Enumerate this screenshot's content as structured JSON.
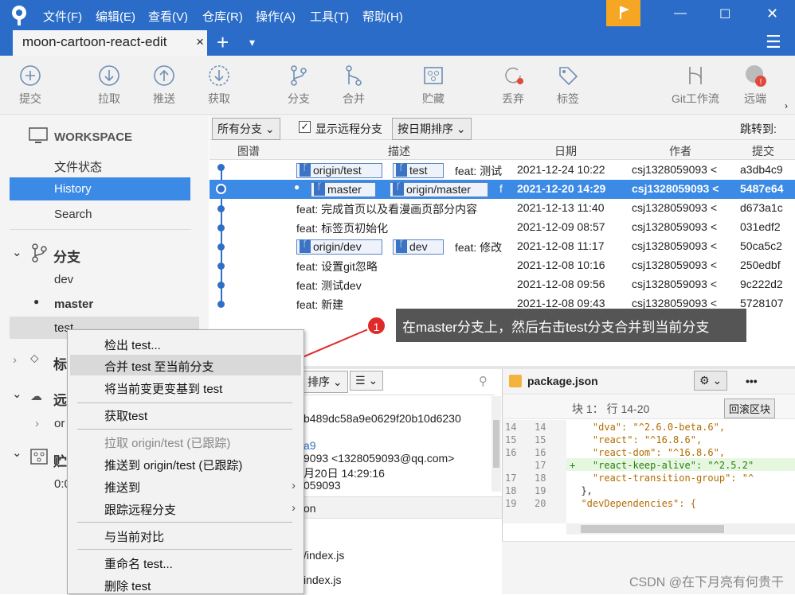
{
  "titlebar": {
    "menus": [
      "文件(F)",
      "编辑(E)",
      "查看(V)",
      "仓库(R)",
      "操作(A)",
      "工具(T)",
      "帮助(H)"
    ],
    "tab_title": "moon-cartoon-react-edit",
    "tab_close": "×",
    "add_tab": "+",
    "dropdown": "▾",
    "minimize": "—",
    "maximize": "☐",
    "close": "✕",
    "menu": "☰"
  },
  "toolbar": {
    "commit": "提交",
    "pull": "拉取",
    "push": "推送",
    "fetch": "获取",
    "branch": "分支",
    "merge": "合并",
    "stash": "贮藏",
    "discard": "丢弃",
    "tag": "标签",
    "gitflow": "Git工作流",
    "remote": "远端"
  },
  "sidebar": {
    "workspace": "WORKSPACE",
    "file_status": "文件状态",
    "history": "History",
    "search": "Search",
    "branches_title": "分支",
    "branches": [
      "dev",
      "master",
      "test"
    ],
    "tags_title": "标",
    "remotes_title": "远",
    "remote_item": "or",
    "stash_title": "贮",
    "stash_item": "0:0"
  },
  "filterbar": {
    "all_branches": "所有分支",
    "show_remote": "显示远程分支",
    "sort_by_date": "按日期排序",
    "jump_to": "跳转到:"
  },
  "columns": {
    "graph": "图谱",
    "desc": "描述",
    "date": "日期",
    "author": "作者",
    "commit": "提交"
  },
  "commits": [
    {
      "tags": [
        "origin/test",
        "test"
      ],
      "desc": "feat: 测试",
      "date": "2021-12-24 10:22",
      "author": "csj1328059093 <",
      "hash": "a3db4c9"
    },
    {
      "tags": [
        "master",
        "origin/master"
      ],
      "desc": "f",
      "date": "2021-12-20 14:29",
      "author": "csj1328059093 <",
      "hash": "5487e64"
    },
    {
      "tags": [],
      "desc": "feat: 完成首页以及看漫画页部分内容",
      "date": "2021-12-13 11:40",
      "author": "csj1328059093 <",
      "hash": "d673a1c"
    },
    {
      "tags": [],
      "desc": "feat: 标签页初始化",
      "date": "2021-12-09 08:57",
      "author": "csj1328059093 <",
      "hash": "031edf2"
    },
    {
      "tags": [
        "origin/dev",
        "dev"
      ],
      "desc": "feat: 修改",
      "date": "2021-12-08 11:17",
      "author": "csj1328059093 <",
      "hash": "50ca5c2"
    },
    {
      "tags": [],
      "desc": "feat: 设置git忽略",
      "date": "2021-12-08 10:16",
      "author": "csj1328059093 <",
      "hash": "250edbf"
    },
    {
      "tags": [],
      "desc": "feat: 测试dev",
      "date": "2021-12-08 09:56",
      "author": "csj1328059093 <",
      "hash": "9c222d2"
    },
    {
      "tags": [],
      "desc": "feat: 新建",
      "date": "2021-12-08 09:43",
      "author": "csj1328059093 <",
      "hash": "5728107"
    }
  ],
  "callout": {
    "badge": "1",
    "text": "在master分支上，然后右击test分支合并到当前分支"
  },
  "midpane": {
    "sort": "排序",
    "list_icon": "☰",
    "hash_line": "b489dc58a9e0629f20b10d6230",
    "short": "a9",
    "author": "9093 <1328059093@qq.com>",
    "date": "月20日 14:29:16",
    "committer": "059093",
    "file_header": "on",
    "files": [
      "/index.js",
      "index.js"
    ]
  },
  "diffpane": {
    "filename": "package.json",
    "gear": "⚙",
    "more": "•••",
    "hunk": "块 1： 行 14-20",
    "revert": "回滚区块",
    "lines": [
      {
        "a": "14",
        "b": "14",
        "text": "    \"dva\": \"^2.6.0-beta.6\","
      },
      {
        "a": "15",
        "b": "15",
        "text": "    \"react\": \"^16.8.6\","
      },
      {
        "a": "16",
        "b": "16",
        "text": "    \"react-dom\": \"^16.8.6\","
      },
      {
        "a": "",
        "b": "17",
        "text": "+   \"react-keep-alive\": \"^2.5.2\""
      },
      {
        "a": "17",
        "b": "18",
        "text": "    \"react-transition-group\": \"^"
      },
      {
        "a": "18",
        "b": "19",
        "text": "  },"
      },
      {
        "a": "19",
        "b": "20",
        "text": "  \"devDependencies\": {"
      }
    ]
  },
  "context_menu": {
    "checkout": "检出 test...",
    "merge": "合并 test 至当前分支",
    "rebase": "将当前变更变基到 test",
    "fetch": "获取test",
    "pull": "拉取 origin/test (已跟踪)",
    "push_origin": "推送到 origin/test (已跟踪)",
    "push_to": "推送到",
    "track": "跟踪远程分支",
    "diff": "与当前对比",
    "rename": "重命名 test...",
    "delete": "删除 test",
    "submenu_arrow": "›"
  },
  "watermark": "CSDN @在下月亮有何贵干"
}
